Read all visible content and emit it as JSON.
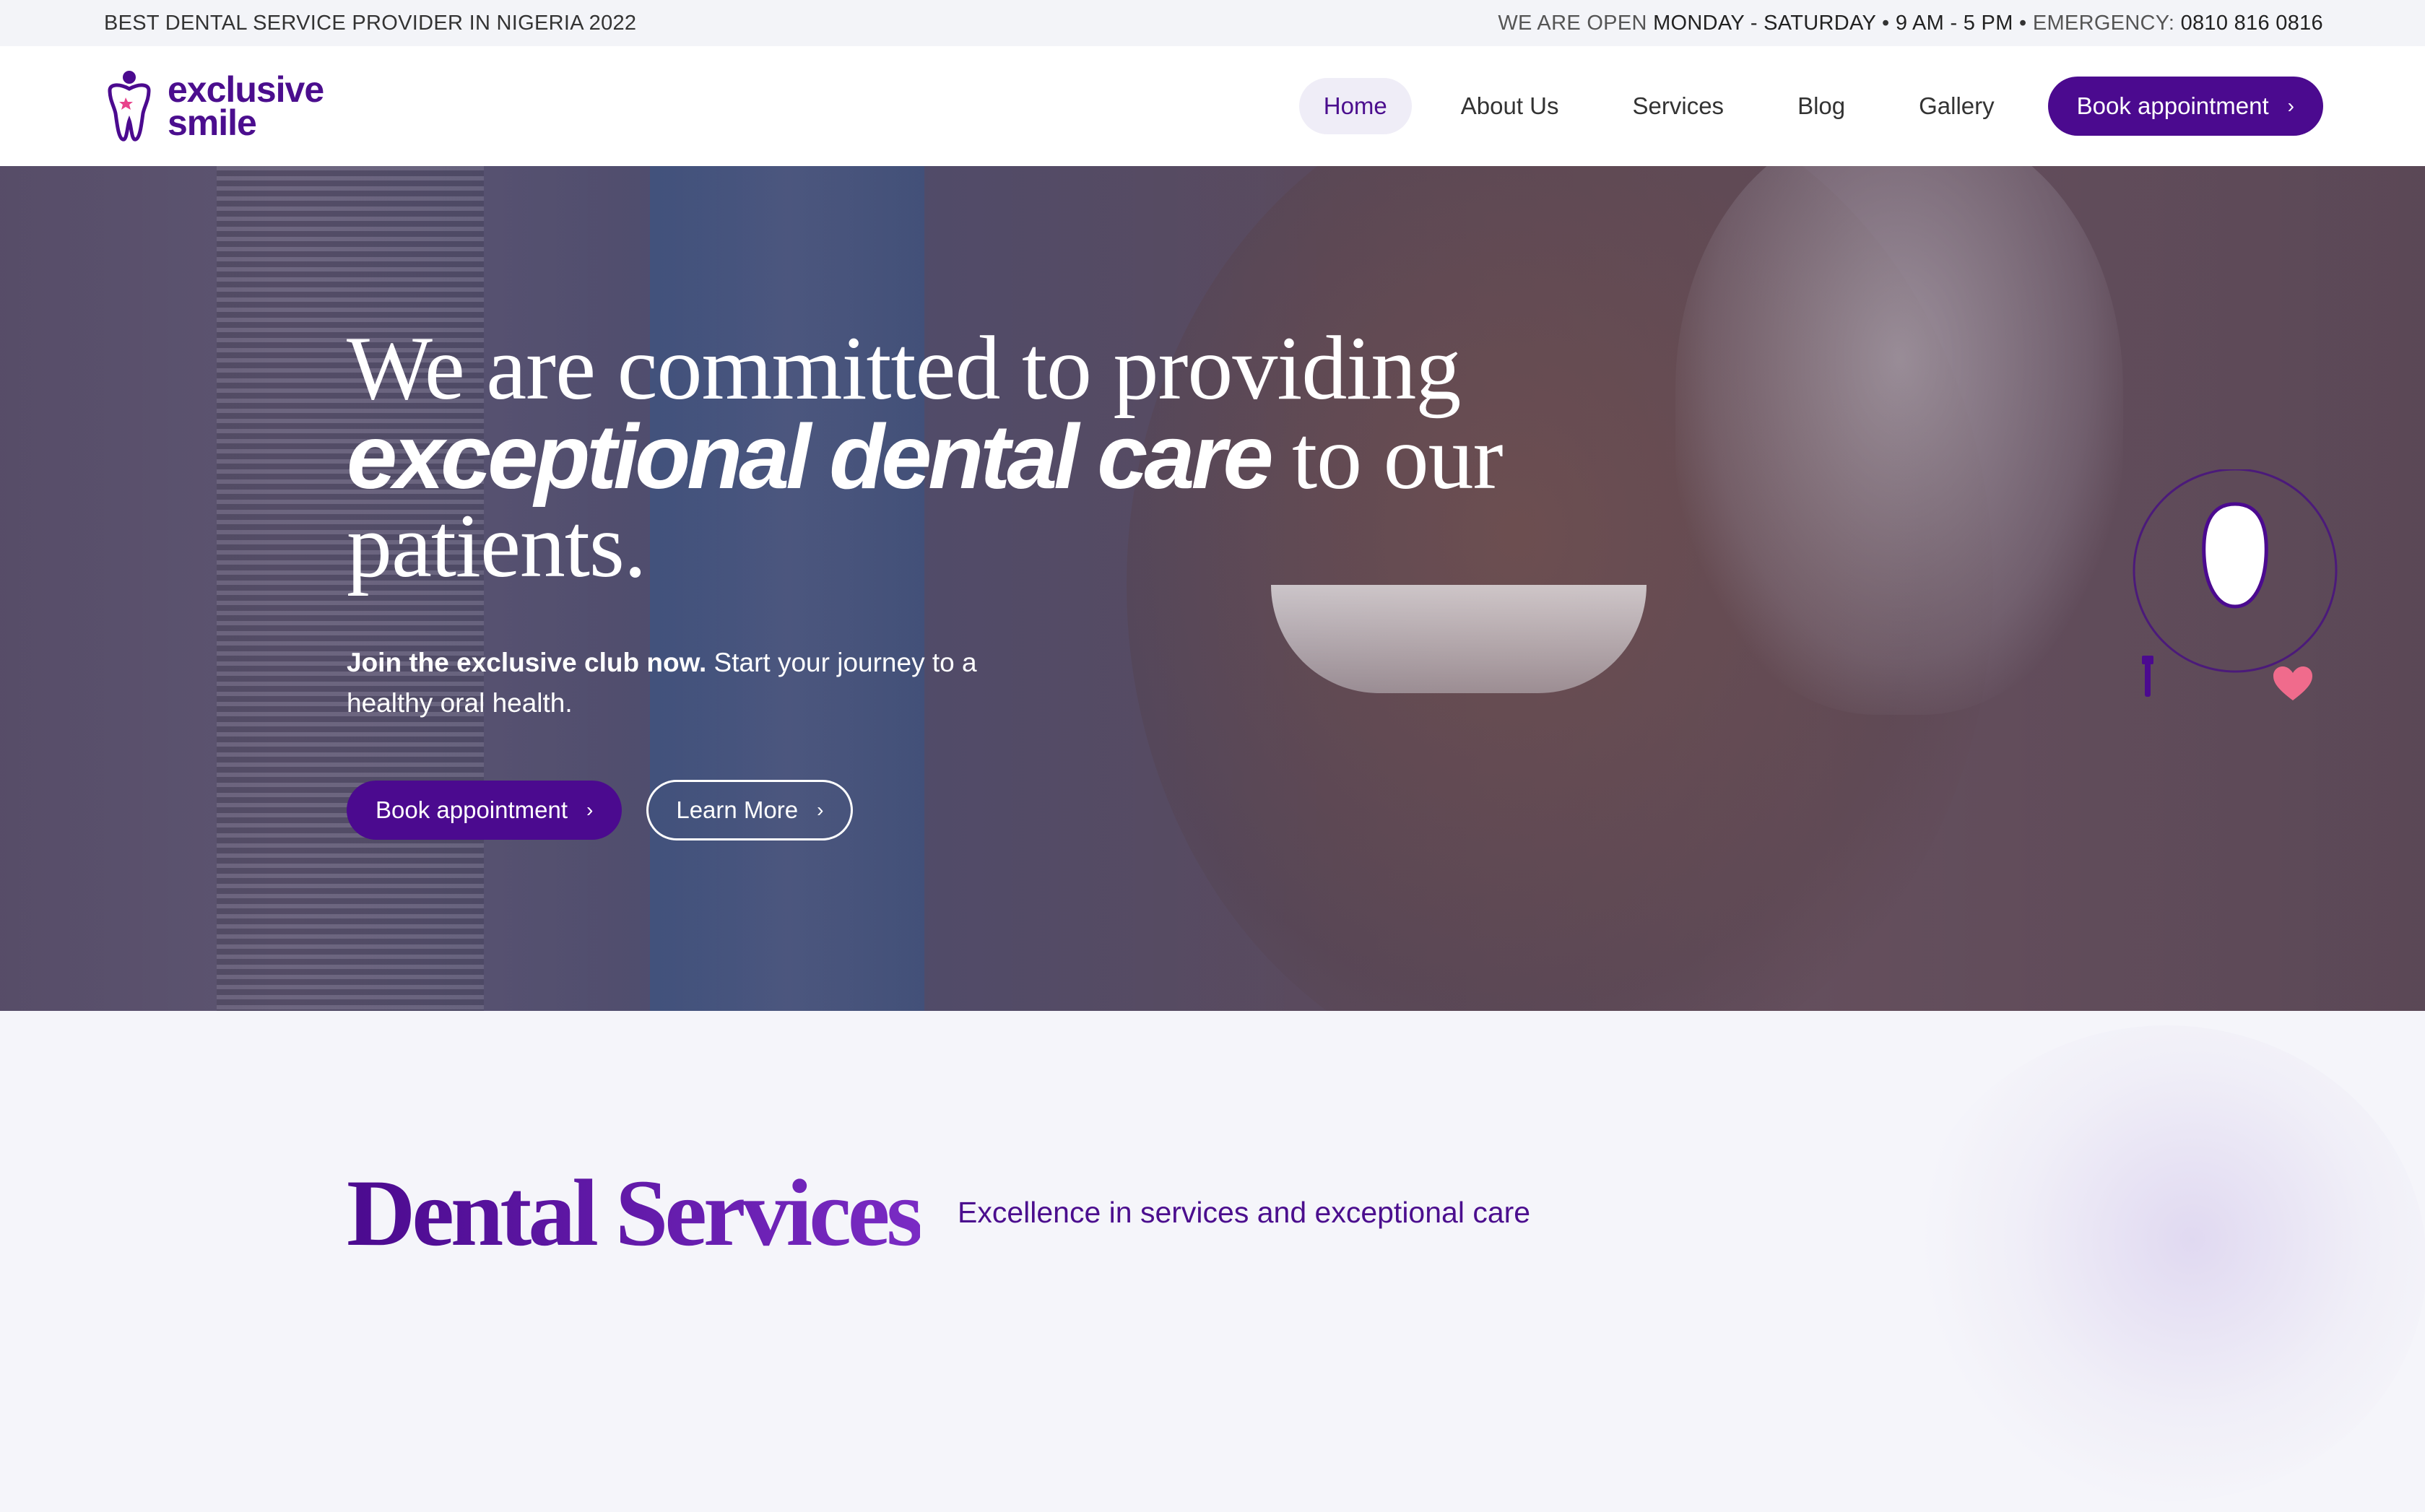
{
  "colors": {
    "brand": "#4b0a8f",
    "nav_active_bg": "#efedf7",
    "heart": "#f06b8c"
  },
  "topbar": {
    "tagline": "BEST DENTAL SERVICE PROVIDER IN NIGERIA 2022",
    "open_label": "WE ARE OPEN",
    "days": "MONDAY - SATURDAY",
    "sep": "•",
    "hours": "9 AM - 5 PM",
    "emergency_label": "EMERGENCY:",
    "emergency_phone": "0810 816 0816"
  },
  "header": {
    "logo_line1": "exclusive",
    "logo_line2": "smile",
    "logo_icon": "tooth-person-icon",
    "nav": [
      {
        "label": "Home",
        "active": true
      },
      {
        "label": "About Us"
      },
      {
        "label": "Services"
      },
      {
        "label": "Blog"
      },
      {
        "label": "Gallery"
      }
    ],
    "cta_label": "Book appointment",
    "cta_icon": "chevron-right-icon"
  },
  "hero": {
    "title_line1": "We are committed to providing",
    "title_emphasis": "exceptional dental care",
    "title_rest": " to our",
    "title_line3": "patients.",
    "sub_bold": "Join the exclusive club now.",
    "sub_text": " Start your journey to a healthy oral health.",
    "primary_label": "Book appointment",
    "secondary_label": "Learn More",
    "deco_icons": [
      "tooth-badge-icon",
      "toothbrush-icon",
      "heart-icon"
    ]
  },
  "services": {
    "title": "Dental Services",
    "subtitle": "Excellence in services and exceptional care"
  }
}
